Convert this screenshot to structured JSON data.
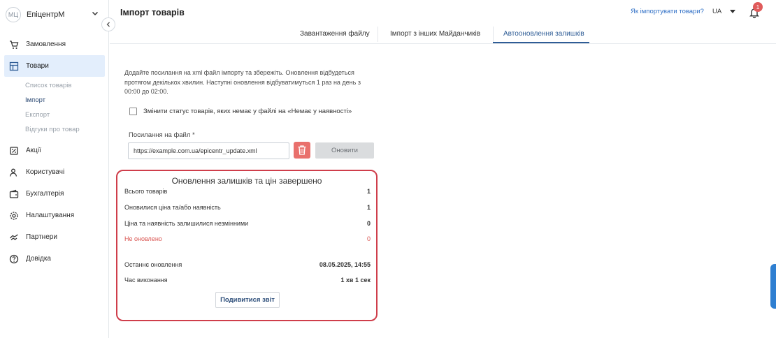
{
  "sidebar": {
    "store_logo": "МЦ",
    "store_name": "ЕпіцентрМ",
    "items": [
      {
        "label": "Замовлення",
        "icon": "cart-icon"
      },
      {
        "label": "Товари",
        "icon": "products-icon",
        "active": true
      },
      {
        "label": "Акції",
        "icon": "promo-icon"
      },
      {
        "label": "Користувачі",
        "icon": "users-icon"
      },
      {
        "label": "Бухгалтерія",
        "icon": "wallet-icon"
      },
      {
        "label": "Налаштування",
        "icon": "gear-icon"
      },
      {
        "label": "Партнери",
        "icon": "handshake-icon"
      },
      {
        "label": "Довідка",
        "icon": "help-icon"
      }
    ],
    "sub_items": [
      "Список товарів",
      "Імпорт",
      "Експорт",
      "Відгуки про товар"
    ]
  },
  "header": {
    "title": "Імпорт товарів",
    "help_link": "Як імпортувати товари?",
    "language": "UA",
    "notifications_count": "1"
  },
  "tabs": [
    "Завантаження файлу",
    "Імпорт з інших Майданчиків",
    "Автооновлення залишків"
  ],
  "active_tab": 2,
  "form": {
    "description": "Додайте посилання на xml файл імпорту та збережіть. Оновлення відбудеться протягом декількох хвилин. Наступні оновлення відбуватимуться 1 раз на день з 00:00 до 02:00.",
    "checkbox_label": "Змінити статус товарів, яких немає у файлі на «Немає у наявності»",
    "file_label": "Посилання на файл *",
    "file_value": "https://example.com.ua/epicentr_update.xml",
    "refresh_label": "Оновити"
  },
  "result": {
    "title": "Оновлення залишків та цін завершено",
    "rows": [
      {
        "label": "Всього товарів",
        "value": "1"
      },
      {
        "label": "Оновилися ціна та/або наявність",
        "value": "1"
      },
      {
        "label": "Ціна та наявність залишилися незмінними",
        "value": "0"
      },
      {
        "label": "Не оновлено",
        "value": "0"
      }
    ],
    "last_update_label": "Останнє оновлення",
    "last_update_value": "08.05.2025, 14:55",
    "duration_label": "Час виконання",
    "duration_value": "1 хв 1 сек",
    "report_button": "Подивитися звіт"
  },
  "colors": {
    "accent": "#2f5d96",
    "danger": "#cf3e4b",
    "active_bg": "#e3eefc"
  }
}
